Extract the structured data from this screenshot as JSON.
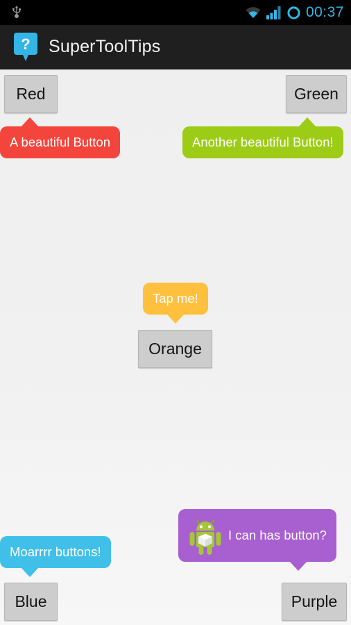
{
  "statusbar": {
    "usb_icon": "usb-icon",
    "wifi_icon": "wifi-icon",
    "signal_icon": "cellular-signal-icon",
    "sync_icon": "circle-sync-icon",
    "time": "00:37",
    "accent_color": "#33b5e5"
  },
  "actionbar": {
    "logo_icon": "question-speech-bubble-icon",
    "logo_glyph": "?",
    "title": "SuperToolTips",
    "background": "#1f1f1f"
  },
  "buttons": [
    {
      "id": "red",
      "label": "Red"
    },
    {
      "id": "green",
      "label": "Green"
    },
    {
      "id": "orange",
      "label": "Orange"
    },
    {
      "id": "blue",
      "label": "Blue"
    },
    {
      "id": "purple",
      "label": "Purple"
    }
  ],
  "tooltips": [
    {
      "id": "red",
      "text": "A beautiful Button",
      "color": "#f4453c"
    },
    {
      "id": "green",
      "text": "Another beautiful Button!",
      "color": "#9ccc16"
    },
    {
      "id": "orange",
      "text": "Tap me!",
      "color": "#ffc13d"
    },
    {
      "id": "blue",
      "text": "Moarrrr buttons!",
      "color": "#40c0e8"
    },
    {
      "id": "purple",
      "text": "I can has button?",
      "color": "#a85fd0",
      "icon": "android-robot-icon"
    }
  ],
  "theme": {
    "button_face": "#cdcdcd",
    "background_top": "#efefef",
    "background_bottom": "#f7f7f7"
  }
}
